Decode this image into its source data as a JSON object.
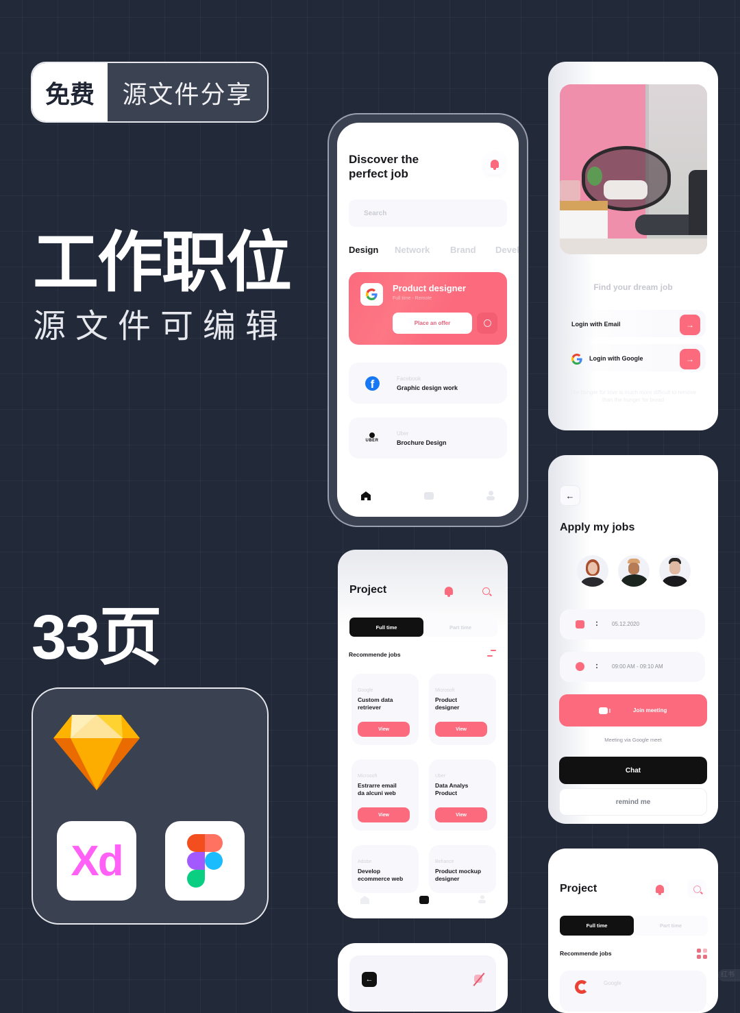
{
  "promo": {
    "badge_left": "免费",
    "badge_right": "源文件分享",
    "title": "工作职位",
    "subtitle": "源文件可编辑",
    "pages": "33页",
    "tools": [
      {
        "name": "Sketch",
        "icon": "sketch-diamond-icon"
      },
      {
        "name": "Xd",
        "icon": "adobe-xd-icon",
        "label": "Xd"
      },
      {
        "name": "Figma",
        "icon": "figma-icon"
      }
    ]
  },
  "colors": {
    "accent": "#fb6b7d",
    "background": "#222a3a",
    "dark": "#111111"
  },
  "discover": {
    "title_line1": "Discover the",
    "title_line2": "perfect job",
    "search_placeholder": "Search",
    "tabs": [
      {
        "label": "Design",
        "active": true
      },
      {
        "label": "Network",
        "active": false
      },
      {
        "label": "Brand",
        "active": false
      },
      {
        "label": "Devel",
        "active": false
      }
    ],
    "featured": {
      "company_icon": "google-icon",
      "title": "Product designer",
      "subtitle": "Full time - Remote",
      "offer_label": "Place an offer"
    },
    "jobs": [
      {
        "company": "Facebook",
        "title": "Graphic design work",
        "icon": "facebook-icon"
      },
      {
        "company": "Uber",
        "title": "Brochure Design",
        "icon": "uber-icon",
        "logo_text": "UBER"
      }
    ],
    "nav": [
      "home-icon",
      "briefcase-icon",
      "profile-icon"
    ]
  },
  "login": {
    "headline": "Find your dream job",
    "email_label": "Login with Email",
    "google_label": "Login with Google",
    "quote": "The hunger for love is much more difficult to remove than the hunger for bread"
  },
  "apply": {
    "title": "Apply my jobs",
    "date": "05.12.2020",
    "time": "09:00 AM - 09:10 AM",
    "join_label": "Join meeting",
    "meeting_note": "Meeting via Google meet",
    "chat_label": "Chat",
    "remind_label": "remind me",
    "separator": ":"
  },
  "project": {
    "title": "Project",
    "tab_full": "Full time",
    "tab_part": "Part time",
    "section": "Recommende jobs",
    "view_label": "View",
    "jobs": [
      {
        "company": "Google",
        "title_1": "Custom data",
        "title_2": "retriever"
      },
      {
        "company": "Microsoft",
        "title_1": "Product",
        "title_2": "designer"
      },
      {
        "company": "Microsoft",
        "title_1": "Estrarre email",
        "title_2": "da alcuni web"
      },
      {
        "company": "Uber",
        "title_1": "Data Analys",
        "title_2": "Product"
      },
      {
        "company": "Adobe",
        "title_1": "Develop",
        "title_2": "ecommerce web"
      },
      {
        "company": "Behance",
        "title_1": "Product mockup",
        "title_2": "designer"
      }
    ]
  },
  "project2": {
    "title": "Project",
    "tab_full": "Full time",
    "tab_part": "Part time",
    "section": "Recommende jobs",
    "first_company": "Google"
  },
  "watermark": "红书"
}
